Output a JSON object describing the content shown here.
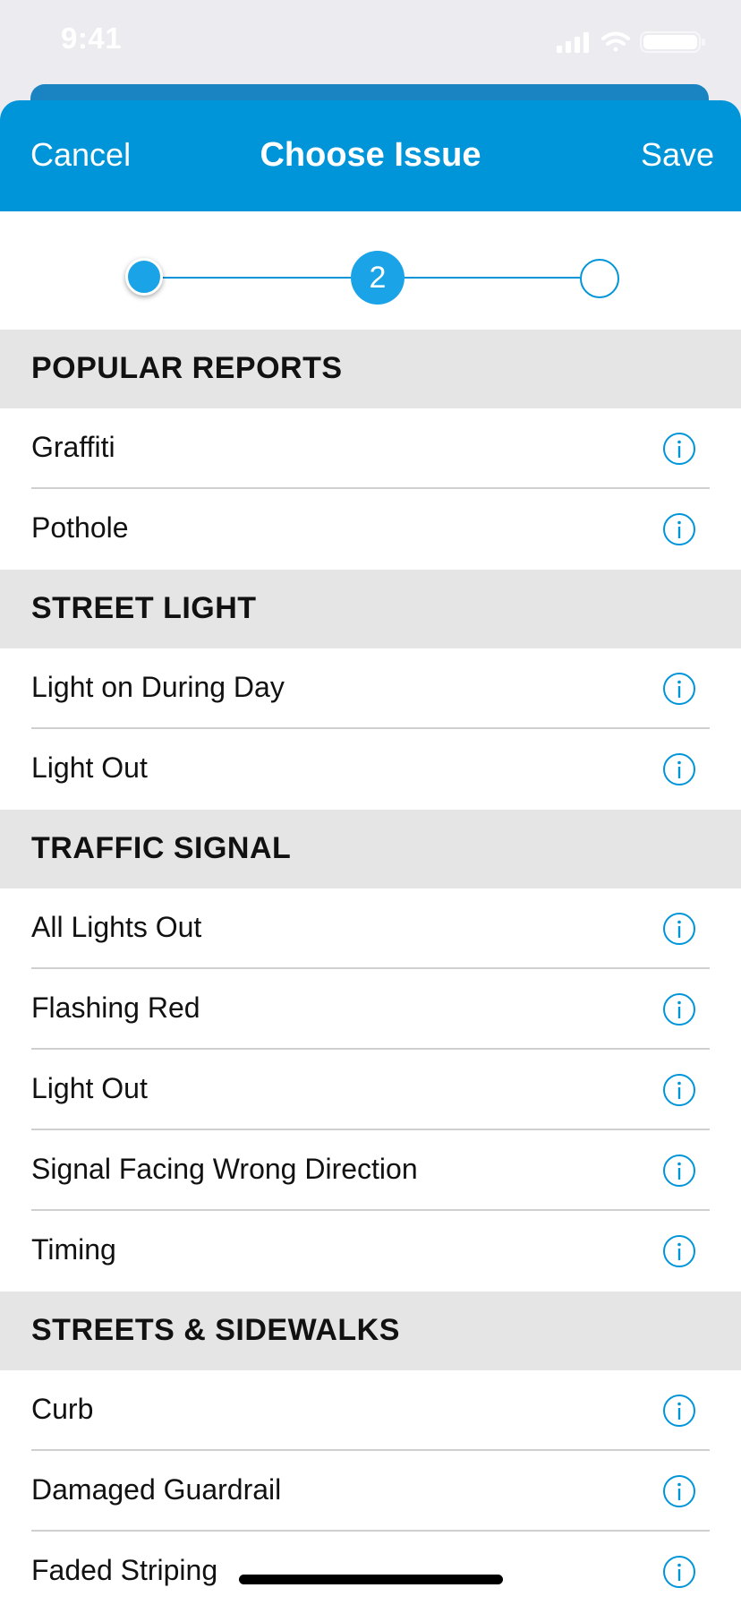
{
  "status_bar": {
    "time": "9:41",
    "icons": [
      "signal-icon",
      "wifi-icon",
      "battery-icon"
    ]
  },
  "nav": {
    "cancel_label": "Cancel",
    "title": "Choose Issue",
    "save_label": "Save"
  },
  "steps": {
    "current": 2,
    "total": 3,
    "current_label": "2"
  },
  "sections": [
    {
      "title": "POPULAR REPORTS",
      "items": [
        "Graffiti",
        "Pothole"
      ]
    },
    {
      "title": "STREET LIGHT",
      "items": [
        "Light on During Day",
        "Light Out"
      ]
    },
    {
      "title": "TRAFFIC SIGNAL",
      "items": [
        "All Lights Out",
        "Flashing Red",
        "Light Out",
        "Signal Facing Wrong Direction",
        "Timing"
      ]
    },
    {
      "title": "STREETS & SIDEWALKS",
      "items": [
        "Curb",
        "Damaged Guardrail",
        "Faded Striping"
      ]
    }
  ],
  "colors": {
    "accent": "#0095d9",
    "step_fill": "#1aa3e6",
    "section_bg": "#e5e5e5",
    "nav_back": "#1a83c2"
  },
  "row_icon": "info-icon"
}
